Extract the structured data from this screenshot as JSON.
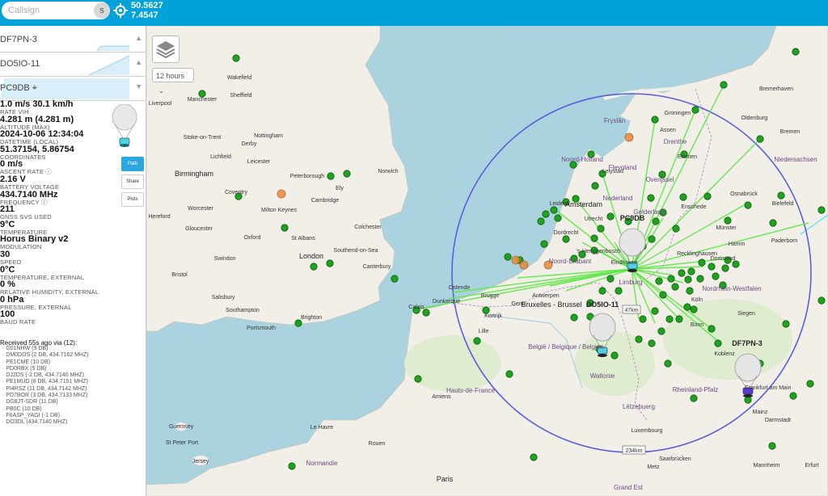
{
  "header": {
    "search_placeholder": "Callsign",
    "search_button": "s",
    "coord_lat": "50.5627",
    "coord_lon": "7.4547"
  },
  "tracks": [
    {
      "label": "DF7PN-3"
    },
    {
      "label": "DO5IO-11"
    },
    {
      "label": "PC9DB"
    }
  ],
  "details": {
    "rows": [
      {
        "value": "1.0 m/s 30.1 km/h",
        "key": "RATE VIH"
      },
      {
        "value": "4.281 m (4.281 m)",
        "key": "ALTITUDE (MAX)"
      },
      {
        "value": "2024-10-06 12:34:04",
        "key": "DATETIME (LOCAL)"
      },
      {
        "value": "51.37154, 5.86754",
        "key": "COORDINATES"
      },
      {
        "value": "0 m/s",
        "key": "ASCENT RATE ⓘ"
      },
      {
        "value": "2.16 V",
        "key": "BATTERY VOLTAGE"
      },
      {
        "value": "434.7140 MHz",
        "key": "FREQUENCY ⓘ"
      },
      {
        "value": "211",
        "key": "GNSS SVS USED"
      },
      {
        "value": "9°C",
        "key": "TEMPERATURE"
      },
      {
        "value": "Horus Binary v2",
        "key": "MODULATION"
      },
      {
        "value": "30",
        "key": "SPEED"
      },
      {
        "value": "0°C",
        "key": "TEMPERATURE, EXTERNAL"
      },
      {
        "value": "0 %",
        "key": "RELATIVE HUMIDITY, EXTERNAL"
      },
      {
        "value": "0 hPa",
        "key": "PRESSURE, EXTERNAL"
      },
      {
        "value": "100",
        "key": "BAUD RATE"
      }
    ],
    "buttons": {
      "path": "Path",
      "share": "Share",
      "plots": "Plots"
    },
    "received_title": "Received 55s ago via (12):",
    "received": [
      "G01NHW (9 DB)",
      "DM0DOS (2 DB, 434.7162 MHZ)",
      "PE1CME (10 DB)",
      "PD0RBX (5 DB)",
      "DJ2DS (-2 DB, 434.7140 MHZ)",
      "PE1MUD (8 DB, 434.7151 MHZ)",
      "PI4RSZ (11 DB, 434.7142 MHZ)",
      "PD7BOR (3 DB, 434.7133 MHZ)",
      "DG8JT-SDR (11 DB)",
      "PB0C (10 DB)",
      "F6ASP_YAGI (-1 DB)",
      "DO3DL (434.7140 MHZ)"
    ]
  },
  "map": {
    "hours_select": "12 hours",
    "scale_radius": "234km",
    "scale_small": "47km",
    "balloon_labels": {
      "pc9db": "PC9DB",
      "do5io": "DO5IO-11",
      "df7pn": "DF7PN-3"
    },
    "cities": {
      "manchester": "Manchester",
      "sheffield": "Sheffield",
      "wakefield": "Wakefield",
      "liverpool": "Liverpool",
      "nottingham": "Nottingham",
      "stoke": "Stoke-on-Trent",
      "derby": "Derby",
      "lichfield": "Lichfield",
      "leicester": "Leicester",
      "birmingham": "Birmingham",
      "peterborough": "Peterborough",
      "norwich": "Norwich",
      "ely": "Ely",
      "cambridge": "Cambridge",
      "coventry": "Coventry",
      "hereford": "Hereford",
      "worcester": "Worcester",
      "gloucester": "Gloucester",
      "milton": "Milton Keynes",
      "oxford": "Oxford",
      "stalbans": "St Albans",
      "colchester": "Colchester",
      "london": "London",
      "southend": "Southend-on-Sea",
      "bristol": "Bristol",
      "swindon": "Swindon",
      "salisbury": "Salisbury",
      "southampton": "Southampton",
      "portsmouth": "Portsmouth",
      "brighton": "Brighton",
      "canterbury": "Canterbury",
      "calais": "Calais",
      "dunkerque": "Dunkerque",
      "ostende": "Ostende",
      "brugge": "Brugge",
      "gent": "Gent",
      "antwerpen": "Antwerpen",
      "bruxelles": "Bruxelles - Brussel",
      "lille": "Lille",
      "kortrijk": "Kortrijk",
      "belgie": "België / Belgique / Belgien",
      "wallonie": "Wallonie",
      "letzebuerg": "Lëtzebuerg",
      "luxembourg": "Luxembourg",
      "amiens": "Amiens",
      "hautsdefrance": "Hauts-de-France",
      "normandie": "Normandie",
      "lehavre": "Le Havre",
      "rouen": "Rouen",
      "paris": "Paris",
      "granderst": "Grand Est",
      "guernsey": "Guernsey",
      "stpeterport": "St Peter Port",
      "jersey": "Jersey",
      "amsterdam": "Amsterdam",
      "utrecht": "Utrecht",
      "nederland": "Nederland",
      "leiden": "Leiden",
      "dordrecht": "Dordrecht",
      "shertogenbosch": "'s-Hertogenbosch",
      "noordbrabant": "Noord-Brabant",
      "limburg": "Limburg",
      "eindhoven": "Eindhoven",
      "lelystad": "Lelystad",
      "flevoland": "Flevoland",
      "overijssel": "Overijssel",
      "gelderland": "Gelderland",
      "assen": "Assen",
      "drenthe": "Drenthe",
      "groningen": "Groningen",
      "fryslan": "Fryslân",
      "emmen": "Emmen",
      "enschede": "Enschede",
      "noordholland": "Noord-Holland",
      "bremerhaven": "Bremerhaven",
      "oldenburg": "Oldenburg",
      "bremen": "Bremen",
      "niedersachsen": "Niedersachsen",
      "osnabruck": "Osnabrück",
      "munster": "Münster",
      "bielefeld": "Bielefeld",
      "paderborn": "Paderborn",
      "hamm": "Hamm",
      "recklinghausen": "Recklinghausen",
      "dortmund": "Dortmund",
      "koln": "Köln",
      "bonn": "Bonn",
      "siegen": "Siegen",
      "koblenz": "Koblenz",
      "rheinland": "Rheinland-Pfalz",
      "frankfurt": "Frankfurt am Main",
      "mainz": "Mainz",
      "darmstadt": "Darmstadt",
      "mannheim": "Mannheim",
      "saarbrucken": "Saarbrücken",
      "metz": "Metz",
      "nordrhein": "Nordrhein-Westfalen",
      "erfurt": "Erfurt"
    }
  },
  "colors": {
    "header": "#00a3d9",
    "circle": "#5b5de0",
    "receiver": "#1fa31f",
    "link": "#5ee847",
    "cyan_path": "#66e0f0"
  }
}
